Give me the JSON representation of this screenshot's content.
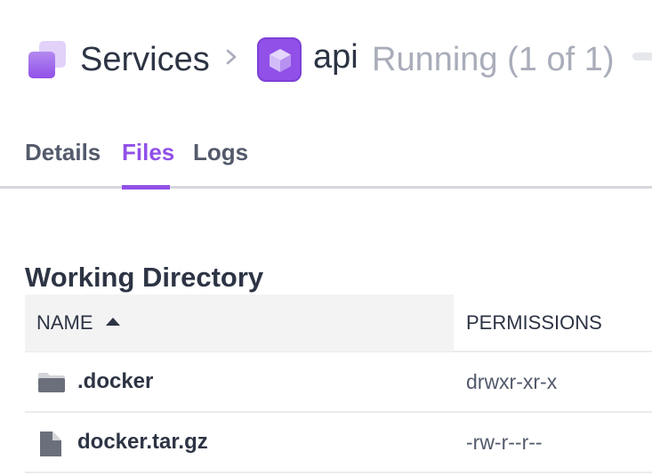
{
  "breadcrumb": {
    "root_label": "Services",
    "root_icon": "services-stack-icon",
    "separator_icon": "chevron-right-icon",
    "current_label": "api",
    "current_icon": "cube-icon",
    "status_text": "Running (1 of 1)"
  },
  "tabs": [
    {
      "label": "Details",
      "active": false
    },
    {
      "label": "Files",
      "active": true
    },
    {
      "label": "Logs",
      "active": false
    }
  ],
  "colors": {
    "accent": "#9150e8",
    "text_primary": "#2d3444",
    "text_muted": "#a9adba",
    "header_bg": "#f3f3f4"
  },
  "section": {
    "title": "Working Directory"
  },
  "table": {
    "columns": [
      {
        "label": "NAME",
        "sort": "ascending",
        "sort_icon": "sort-ascending-icon"
      },
      {
        "label": "PERMISSIONS"
      }
    ],
    "rows": [
      {
        "type": "folder",
        "icon": "folder-icon",
        "name": ".docker",
        "permissions": "drwxr-xr-x"
      },
      {
        "type": "file",
        "icon": "file-icon",
        "name": "docker.tar.gz",
        "permissions": "-rw-r--r--"
      }
    ]
  }
}
